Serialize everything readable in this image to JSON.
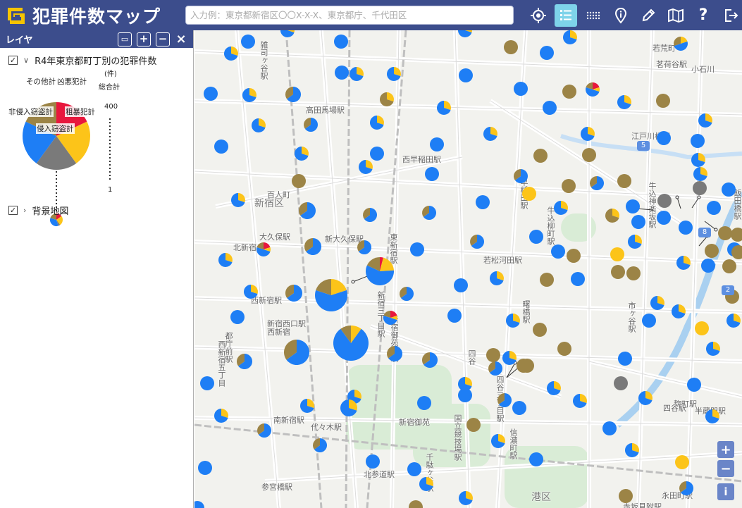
{
  "header": {
    "app_title": "犯罪件数マップ",
    "search_placeholder": "入力例：東京都新宿区〇〇X-X-X、東京都庁、千代田区",
    "tools": [
      {
        "icon": "locate-icon",
        "active": false
      },
      {
        "icon": "layer-list-icon",
        "active": true
      },
      {
        "icon": "grid-icon",
        "active": false
      },
      {
        "icon": "info-pin-icon",
        "active": false
      },
      {
        "icon": "pencil-icon",
        "active": false
      },
      {
        "icon": "map-info-icon",
        "active": false
      },
      {
        "icon": "help-icon",
        "active": false
      },
      {
        "icon": "logout-icon",
        "active": false
      }
    ]
  },
  "panel": {
    "title": "レイヤ",
    "add_folder_icon": "add-folder-icon",
    "expand_icon": "plus-square-icon",
    "collapse_icon": "minus-square-icon",
    "close_icon": "close-icon",
    "layers": [
      {
        "label": "R4年東京都町丁別の犯罪件数",
        "checked": true,
        "expanded": true
      },
      {
        "label": "背景地図",
        "checked": true,
        "expanded": false
      }
    ],
    "legend": {
      "unit": "(件)",
      "total_label": "総合計",
      "max_value": "400",
      "min_value": "1",
      "categories": [
        {
          "name": "凶悪犯計",
          "color": "#e8173d",
          "share": 0.18
        },
        {
          "name": "粗暴犯計",
          "color": "#fcc419",
          "share": 0.22
        },
        {
          "name": "侵入窃盗計",
          "color": "#7a7a7a",
          "share": 0.2
        },
        {
          "name": "非侵入窃盗計",
          "color": "#1e7ef5",
          "share": 0.22
        },
        {
          "name": "その他計",
          "color": "#9c8446",
          "share": 0.18
        }
      ]
    }
  },
  "colors": {
    "header_bg": "#3c4d8c",
    "accent": "#7ed3ea",
    "zoom_btn": "#6a85c8"
  },
  "map": {
    "labels": [
      {
        "text": "高田馬場駅"
      },
      {
        "text": "西早稲田駅"
      },
      {
        "text": "江戸川橋駅"
      },
      {
        "text": "小石川"
      },
      {
        "text": "若荒町"
      },
      {
        "text": "新宿区"
      },
      {
        "text": "百人町"
      },
      {
        "text": "大久保駅"
      },
      {
        "text": "新大久保駅"
      },
      {
        "text": "北新宿"
      },
      {
        "text": "若松河田駅"
      },
      {
        "text": "西新宿駅"
      },
      {
        "text": "新宿西口駅"
      },
      {
        "text": "都庁前駅"
      },
      {
        "text": "南新宿駅"
      },
      {
        "text": "代々木駅"
      },
      {
        "text": "新宿御苑"
      },
      {
        "text": "北参道駅"
      },
      {
        "text": "参宮橋駅"
      },
      {
        "text": "四谷"
      },
      {
        "text": "麹町駅"
      },
      {
        "text": "半蔵門駅"
      },
      {
        "text": "永田町駅"
      },
      {
        "text": "赤坂見附駅"
      },
      {
        "text": "港区"
      },
      {
        "text": "曙橋駅"
      },
      {
        "text": "西新宿"
      },
      {
        "text": "飯田橋駅"
      },
      {
        "text": "牛込神楽坂駅"
      },
      {
        "text": "牛込柳町駅"
      },
      {
        "text": "早稲田駅"
      },
      {
        "text": "国立競技場駅"
      },
      {
        "text": "信濃町駅"
      },
      {
        "text": "千駄ヶ谷駅"
      },
      {
        "text": "四谷三丁目駅"
      },
      {
        "text": "市ヶ谷駅"
      },
      {
        "text": "東新宿駅"
      },
      {
        "text": "新宿三丁目駅"
      },
      {
        "text": "新宿御苑前駅"
      },
      {
        "text": "四谷駅"
      },
      {
        "text": "雑司ヶ谷駅"
      },
      {
        "text": "茗荷谷駅"
      },
      {
        "text": "西新宿五丁目"
      }
    ],
    "route_numbers": [
      "5",
      "8",
      "2"
    ],
    "zoom_in": "+",
    "zoom_out": "−",
    "info": "i"
  }
}
